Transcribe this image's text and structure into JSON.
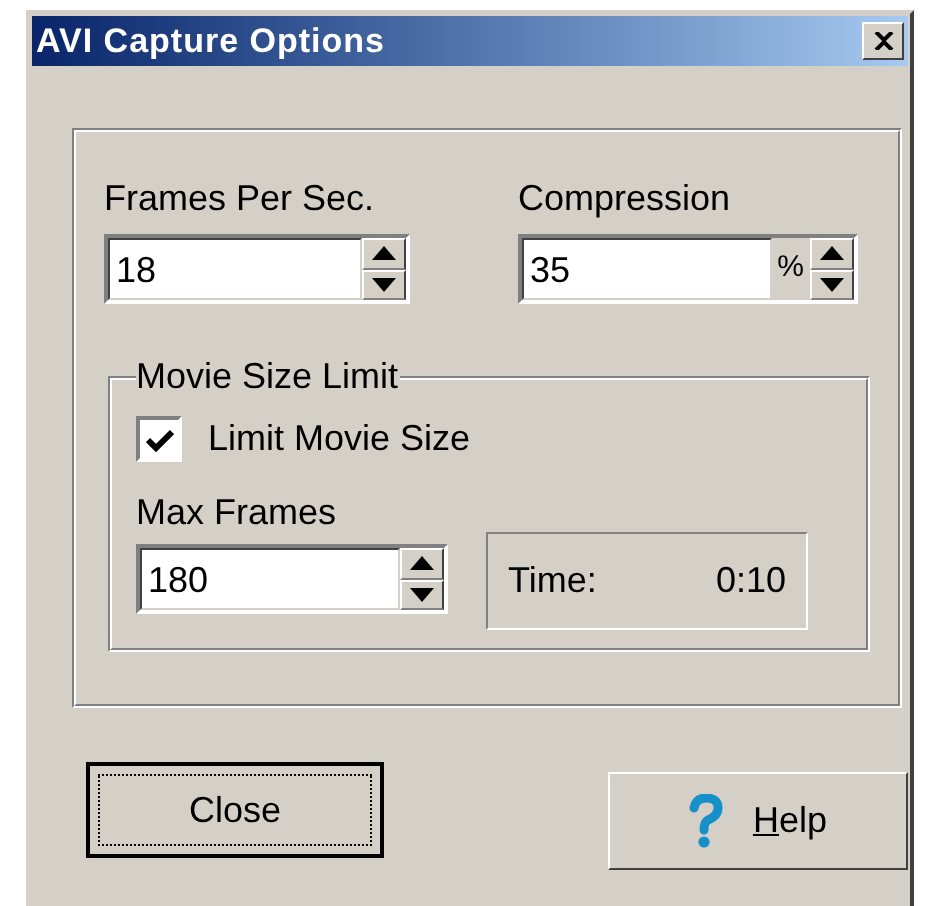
{
  "window": {
    "title": "AVI Capture Options"
  },
  "fields": [
    {
      "label": "Frames Per Sec.",
      "value": "18"
    },
    {
      "label": "Compression",
      "value": "35",
      "unit": "%"
    }
  ],
  "movie_size_limit": {
    "title": "Movie Size Limit",
    "checkbox": {
      "label": "Limit Movie Size",
      "checked": true
    },
    "max_frames": {
      "label": "Max Frames",
      "value": "180"
    },
    "time": {
      "label": "Time:",
      "value": "0:10"
    }
  },
  "buttons": [
    {
      "kind": "close",
      "label": "Close",
      "default": true
    },
    {
      "kind": "help",
      "mnemonic": "H",
      "rest": "elp",
      "default": false
    }
  ]
}
